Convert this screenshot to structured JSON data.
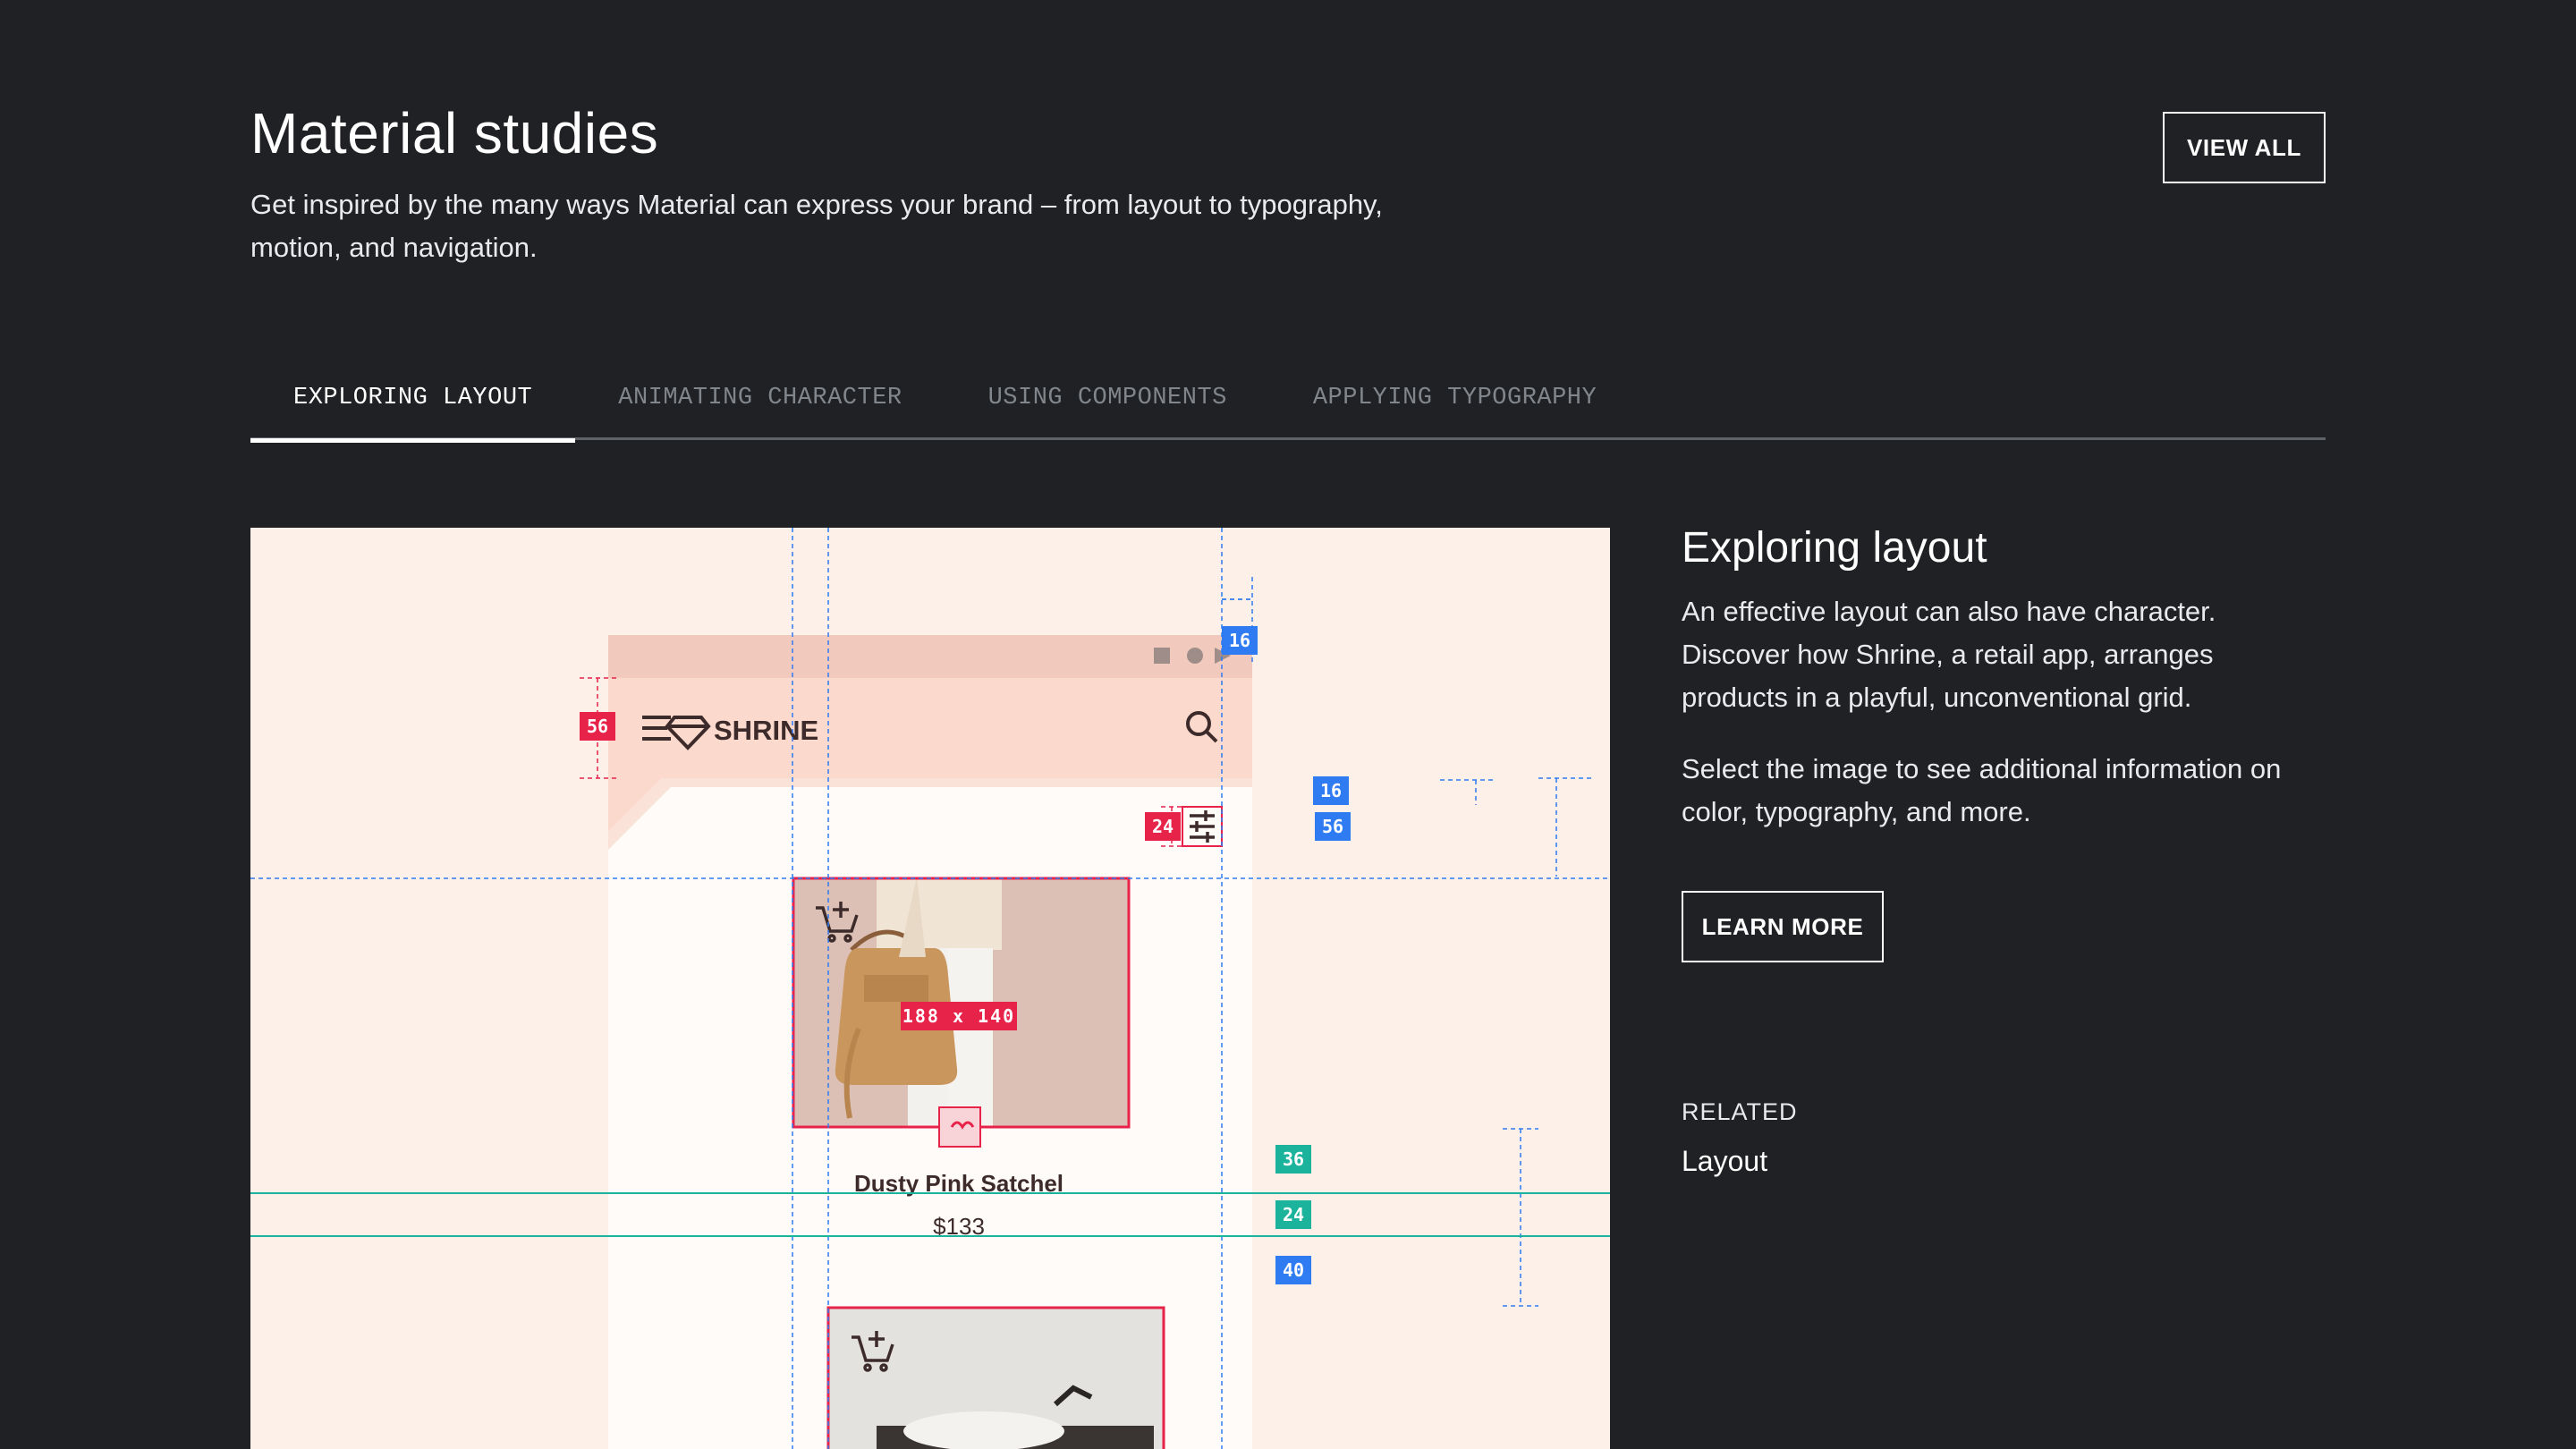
{
  "header": {
    "title": "Material studies",
    "description": "Get inspired by the many ways Material can express your brand – from layout to typography, motion, and navigation.",
    "view_all": "VIEW ALL"
  },
  "tabs": [
    {
      "label": "EXPLORING LAYOUT",
      "active": true
    },
    {
      "label": "ANIMATING CHARACTER",
      "active": false
    },
    {
      "label": "USING COMPONENTS",
      "active": false
    },
    {
      "label": "APPLYING TYPOGRAPHY",
      "active": false
    }
  ],
  "study": {
    "brand": "SHRINE",
    "product_name": "Dusty Pink Satchel",
    "product_price": "$133",
    "size_label": "188 x 140",
    "specs": {
      "appbar_height": "56",
      "top_margin": "16",
      "filter_gap": "24",
      "right_margin": "16",
      "right_height": "56",
      "text_gap_a": "36",
      "text_gap_b": "24",
      "bottom_gap": "40"
    },
    "colors": {
      "background": "#fdf0e8",
      "appbar": "#fbd9cc",
      "spec_red": "#e8234a",
      "spec_blue": "#2f7bf2",
      "spec_teal": "#1bb39c"
    }
  },
  "info": {
    "title": "Exploring layout",
    "paragraph1": "An effective layout can also have character. Discover how Shrine, a retail app, arranges products in a playful, unconventional grid.",
    "paragraph2": "Select the image to see additional information on color, typography, and more.",
    "learn_more": "LEARN MORE",
    "related_label": "RELATED",
    "related_link": "Layout"
  }
}
